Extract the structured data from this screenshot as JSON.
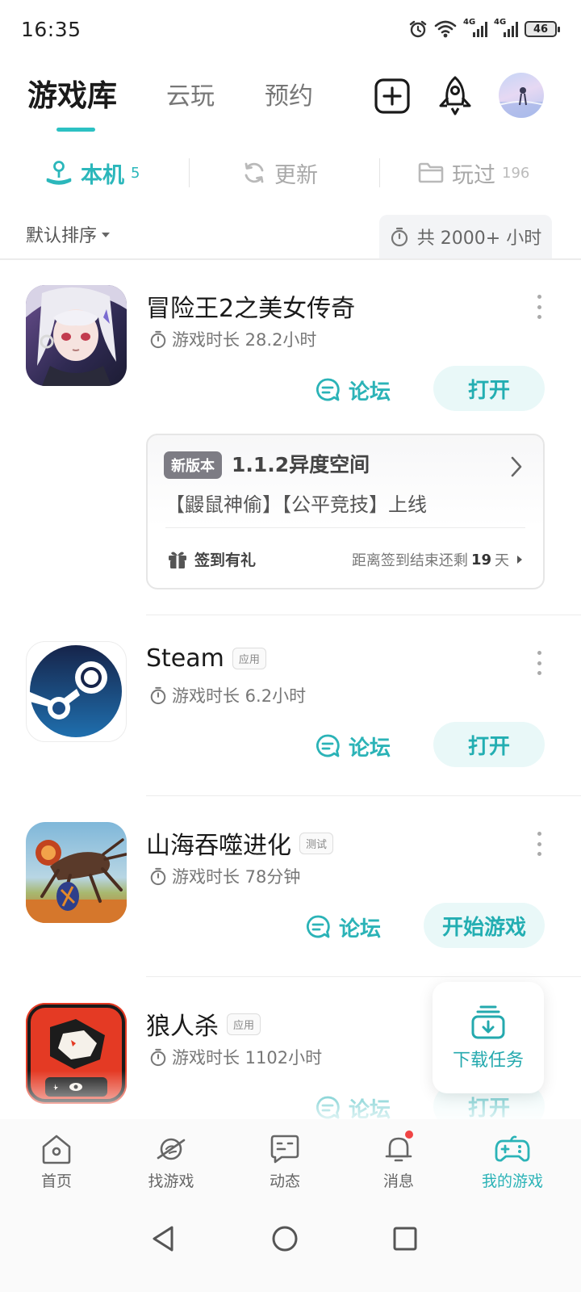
{
  "status_bar": {
    "time": "16:35",
    "net1": "4G",
    "net2": "4G",
    "battery": "46"
  },
  "header": {
    "tabs": [
      {
        "label": "游戏库",
        "active": true
      },
      {
        "label": "云玩",
        "active": false
      },
      {
        "label": "预约",
        "active": false
      }
    ],
    "icons": [
      "add-icon",
      "rocket-icon",
      "avatar"
    ]
  },
  "sub_tabs": [
    {
      "label": "本机",
      "count": "5",
      "icon": "joystick-icon",
      "active": true
    },
    {
      "label": "更新",
      "count": "",
      "icon": "refresh-icon",
      "active": false
    },
    {
      "label": "玩过",
      "count": "196",
      "icon": "folder-icon",
      "active": false
    }
  ],
  "sort": {
    "label": "默认排序",
    "total": "共 2000+ 小时"
  },
  "games": [
    {
      "name": "冒险王2之美女传奇",
      "badge": "",
      "playtime": "游戏时长 28.2小时",
      "forum": "论坛",
      "action": "打开"
    },
    {
      "name": "Steam",
      "badge": "应用",
      "playtime": "游戏时长 6.2小时",
      "forum": "论坛",
      "action": "打开"
    },
    {
      "name": "山海吞噬进化",
      "badge": "测试",
      "playtime": "游戏时长 78分钟",
      "forum": "论坛",
      "action": "开始游戏"
    },
    {
      "name": "狼人杀",
      "badge": "应用",
      "playtime": "游戏时长 1102小时",
      "forum": "论坛",
      "action": "打开"
    }
  ],
  "news_card": {
    "tag": "新版本",
    "title": "1.1.2异度空间",
    "body": "【鼹鼠神偷】【公平竞技】上线",
    "checkin_label": "签到有礼",
    "remain_prefix": "距离签到结束还剩",
    "remain_days": "19",
    "remain_suffix": "天"
  },
  "float_download": {
    "label": "下载任务"
  },
  "bottom_nav": [
    {
      "label": "首页",
      "icon": "home-icon",
      "active": false
    },
    {
      "label": "找游戏",
      "icon": "planet-icon",
      "active": false
    },
    {
      "label": "动态",
      "icon": "chat-icon",
      "active": false
    },
    {
      "label": "消息",
      "icon": "bell-icon",
      "active": false,
      "notification": true
    },
    {
      "label": "我的游戏",
      "icon": "gamepad-icon",
      "active": true
    }
  ],
  "colors": {
    "accent": "#2bb3b7",
    "accent_light": "#e9f8f8",
    "badge_dot": "#f04444"
  }
}
